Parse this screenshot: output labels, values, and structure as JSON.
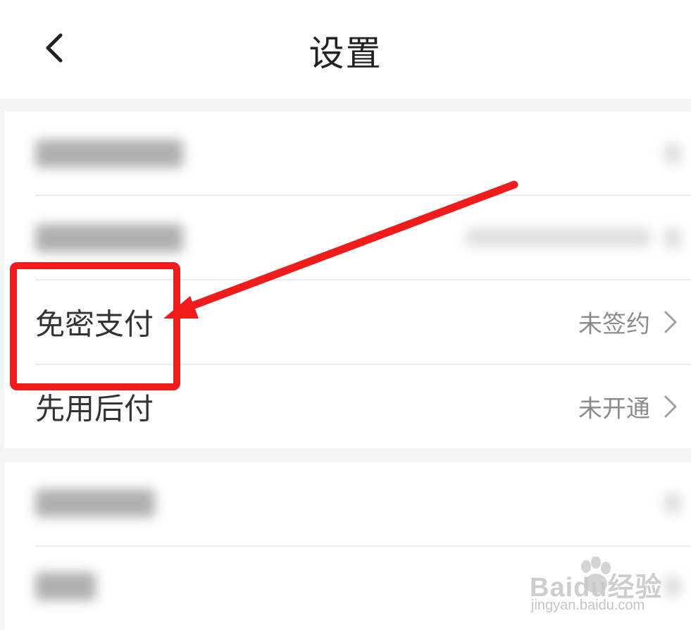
{
  "header": {
    "title": "设置"
  },
  "settings": {
    "rows": [
      {
        "label": "免密支付",
        "value": "未签约"
      },
      {
        "label": "先用后付",
        "value": "未开通"
      }
    ]
  },
  "colors": {
    "annotation": "#f01c1c",
    "label": "#333333",
    "value": "#8c8c8c",
    "background": "#f4f4f4"
  },
  "watermark": {
    "logo": "Baidu经验",
    "url": "jingyan.baidu.com"
  }
}
